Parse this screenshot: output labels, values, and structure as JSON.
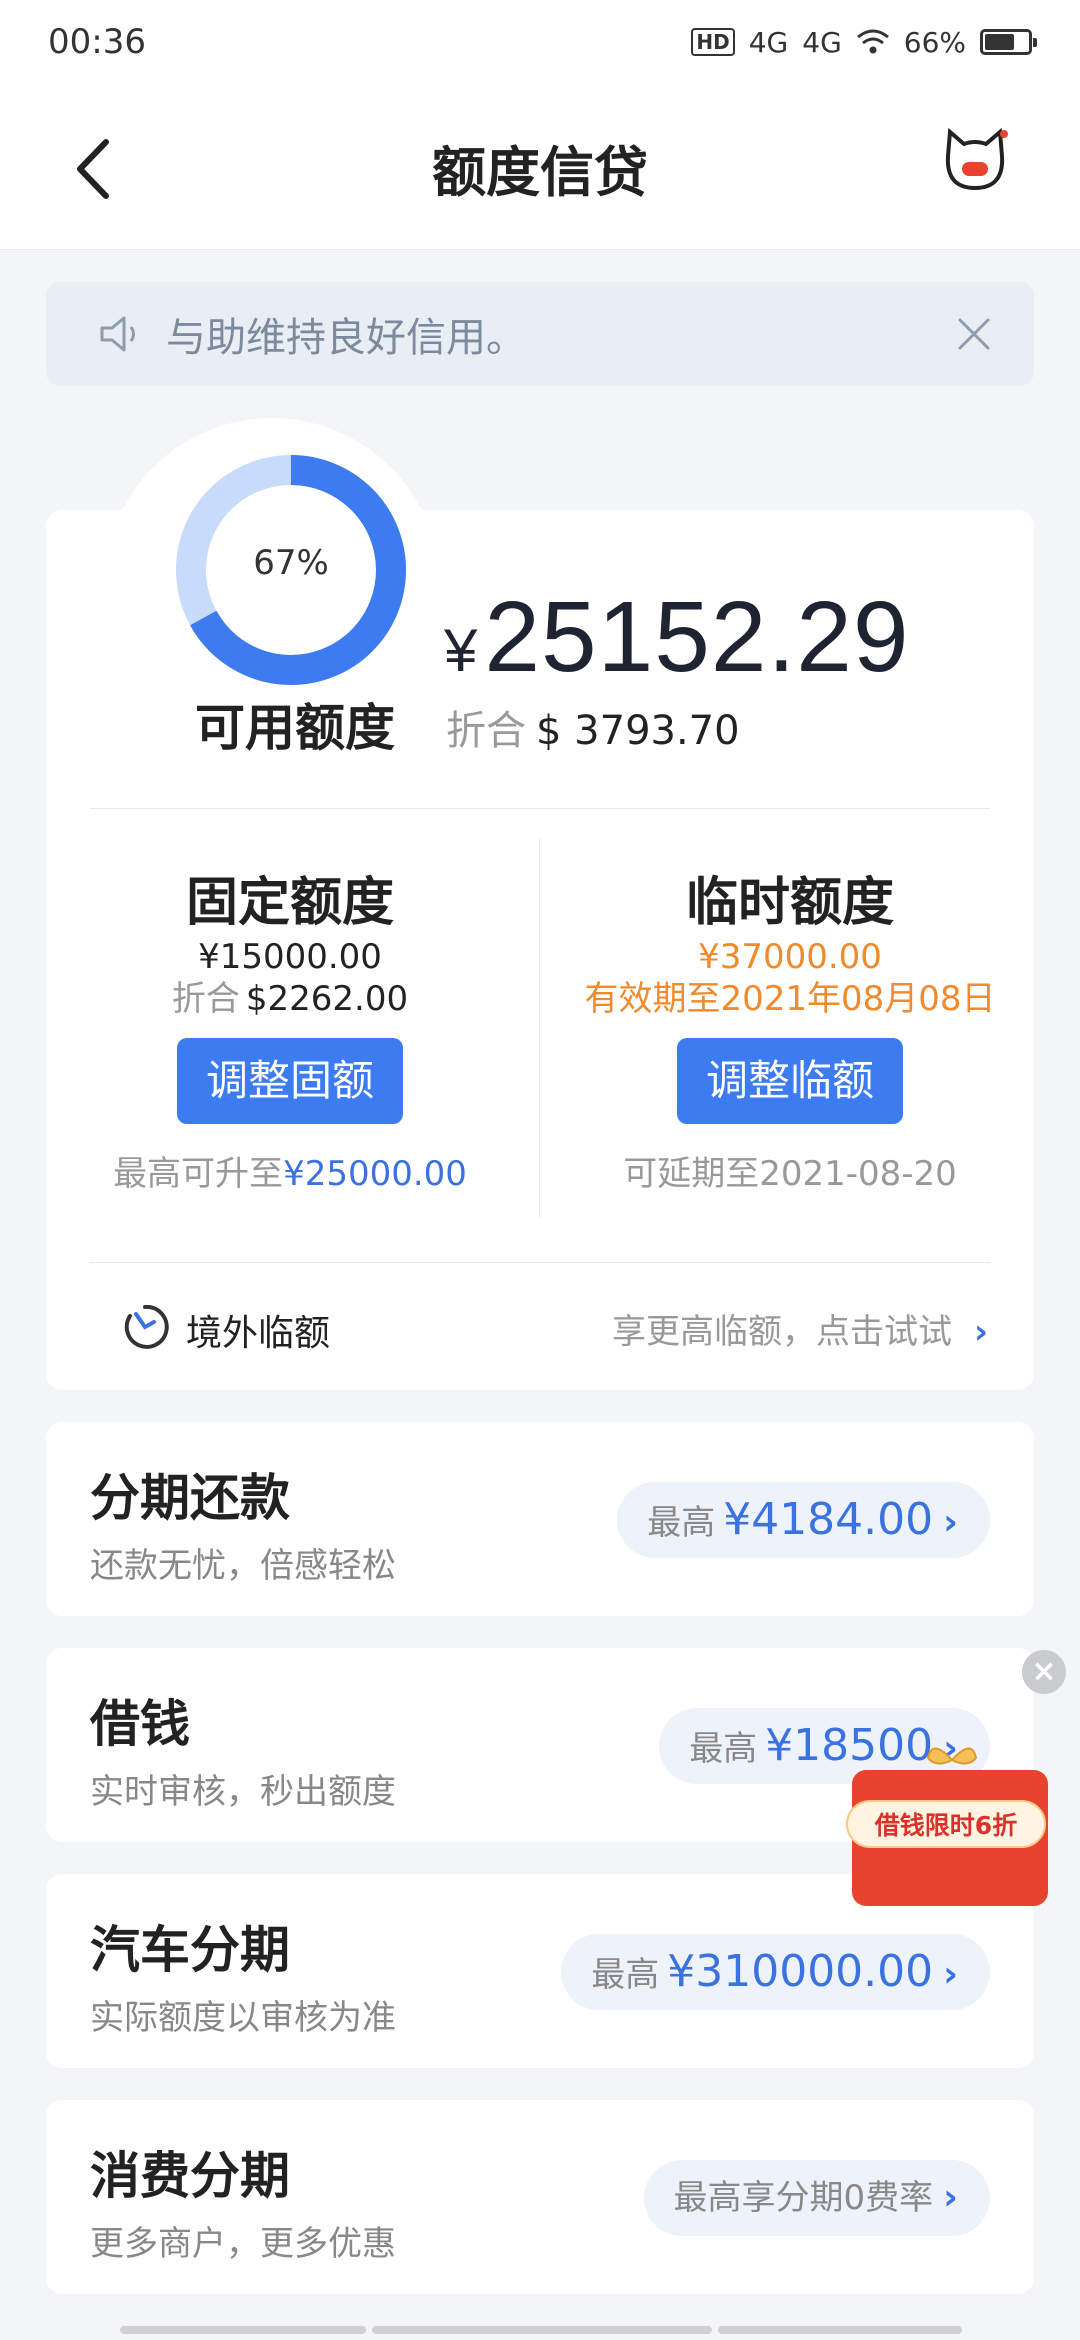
{
  "status_bar": {
    "time": "00:36",
    "network_1": "4G",
    "network_2": "4G",
    "hd": "HD",
    "battery": "66%",
    "battery_level": 0.66
  },
  "nav": {
    "title": "额度信贷"
  },
  "notice": {
    "text": "与助维持良好信用。"
  },
  "credit": {
    "ring_percent_label": "67%",
    "ring_percent": 67,
    "available_label": "可用额度",
    "currency_symbol": "¥",
    "available_amount": "25152.29",
    "usd_prefix": "折合",
    "usd_amount": "$ 3793.70"
  },
  "fixed": {
    "title": "固定额度",
    "amount": "¥15000.00",
    "usd_prefix": "折合",
    "usd_amount": "$2262.00",
    "button": "调整固额",
    "foot_prefix": "最高可升至",
    "foot_value": "¥25000.00"
  },
  "temp": {
    "title": "临时额度",
    "amount": "¥37000.00",
    "validity": "有效期至2021年08月08日",
    "button": "调整临额",
    "foot": "可延期至2021-08-20"
  },
  "overseas": {
    "label": "境外临额",
    "hint": "享更高临额，点击试试",
    "chevron": "›"
  },
  "products": [
    {
      "title": "分期还款",
      "sub": "还款无忧，倍感轻松",
      "prefix": "最高",
      "value": "¥4184.00",
      "chevron": "›"
    },
    {
      "title": "借钱",
      "sub": "实时审核，秒出额度",
      "prefix": "最高",
      "value": "¥18500",
      "chevron": "›"
    },
    {
      "title": "汽车分期",
      "sub": "实际额度以审核为准",
      "prefix": "最高",
      "value": "¥310000.00",
      "chevron": "›"
    },
    {
      "title": "消费分期",
      "sub": "更多商户，更多优惠",
      "prefix": "最高享分期0费率",
      "value": "",
      "chevron": "›"
    }
  ],
  "promo": {
    "text": "借钱限时6折",
    "close": "×"
  },
  "colors": {
    "accent": "#3c7bf0",
    "orange": "#f08a2b",
    "background": "#f4f5f7"
  }
}
